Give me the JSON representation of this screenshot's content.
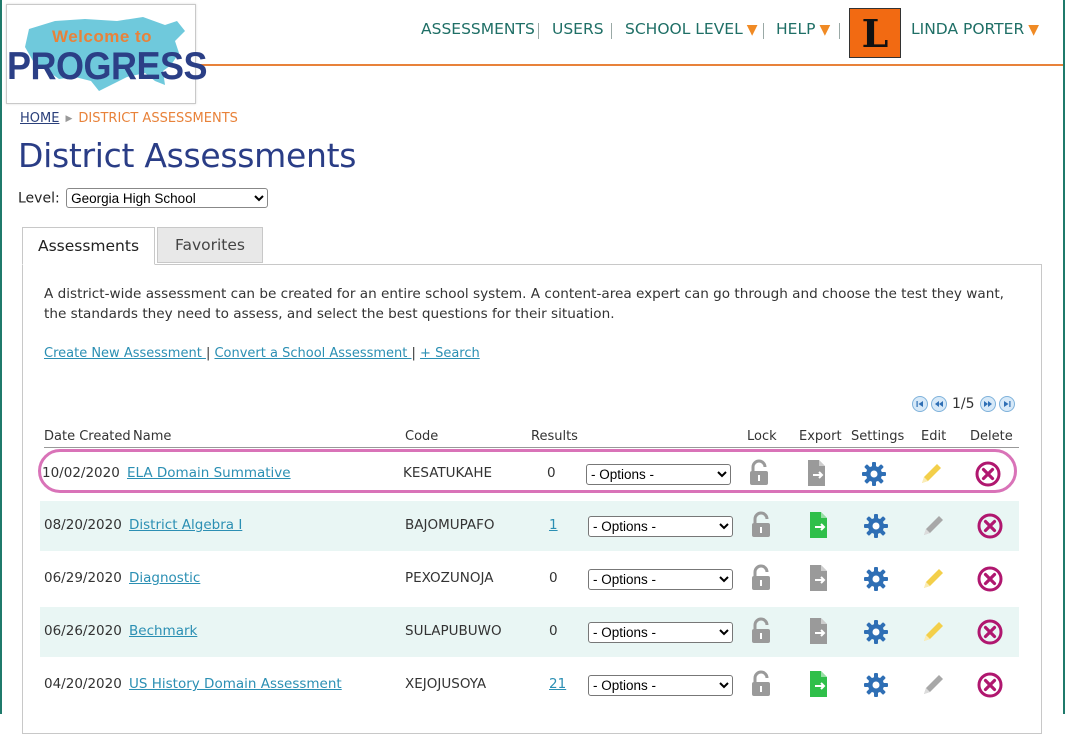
{
  "logo": {
    "welcome": "Welcome to",
    "progress": "PROGRESS"
  },
  "nav": {
    "assessments": "ASSESSMENTS",
    "users": "USERS",
    "school_level": "SCHOOL LEVEL",
    "help": "HELP",
    "avatar_letter": "L",
    "user_name": "LINDA PORTER"
  },
  "breadcrumb": {
    "home": "HOME",
    "current": "DISTRICT ASSESSMENTS"
  },
  "page_title": "District Assessments",
  "level": {
    "label": "Level:",
    "selected": "Georgia High School"
  },
  "tabs": [
    {
      "label": "Assessments"
    },
    {
      "label": "Favorites"
    }
  ],
  "description": "A district-wide assessment can be created for an entire school system. A content-area expert can go through and choose the test they want, the standards they need to assess, and select the best questions for their situation.",
  "links": {
    "create": "Create New Assessment ",
    "convert": "Convert a School Assessment ",
    "search": "+ Search",
    "sep": "|"
  },
  "pager": {
    "text": "1/5"
  },
  "table": {
    "headers": {
      "date": "Date Created",
      "name": "Name",
      "code": "Code",
      "results": "Results",
      "lock": "Lock",
      "export": "Export",
      "settings": "Settings",
      "edit": "Edit",
      "delete": "Delete"
    },
    "options_label": "- Options -",
    "rows": [
      {
        "date": "10/02/2020",
        "name": "ELA Domain Summative",
        "code": "KESATUKAHE",
        "results": "0"
      },
      {
        "date": "08/20/2020",
        "name": "District Algebra I",
        "code": "BAJOMUPAFO",
        "results": "1"
      },
      {
        "date": "06/29/2020",
        "name": "Diagnostic",
        "code": "PEXOZUNOJA",
        "results": "0"
      },
      {
        "date": "06/26/2020",
        "name": "Bechmark",
        "code": "SULAPUBUWO",
        "results": "0"
      },
      {
        "date": "04/20/2020",
        "name": "US History Domain Assessment",
        "code": "XEJOJUSOYA",
        "results": "21"
      }
    ]
  },
  "colors": {
    "nav_text": "#1f6f66",
    "accent_orange": "#e8823a",
    "title_blue": "#2a3d86",
    "link_blue": "#2b8fb3",
    "row_shade": "#e9f6f4",
    "highlight": "#d973b8",
    "export_green": "#2fbf4a",
    "gear_blue": "#2f6fb5",
    "edit_yellow": "#f3cf4a",
    "delete_magenta": "#b0176f"
  }
}
